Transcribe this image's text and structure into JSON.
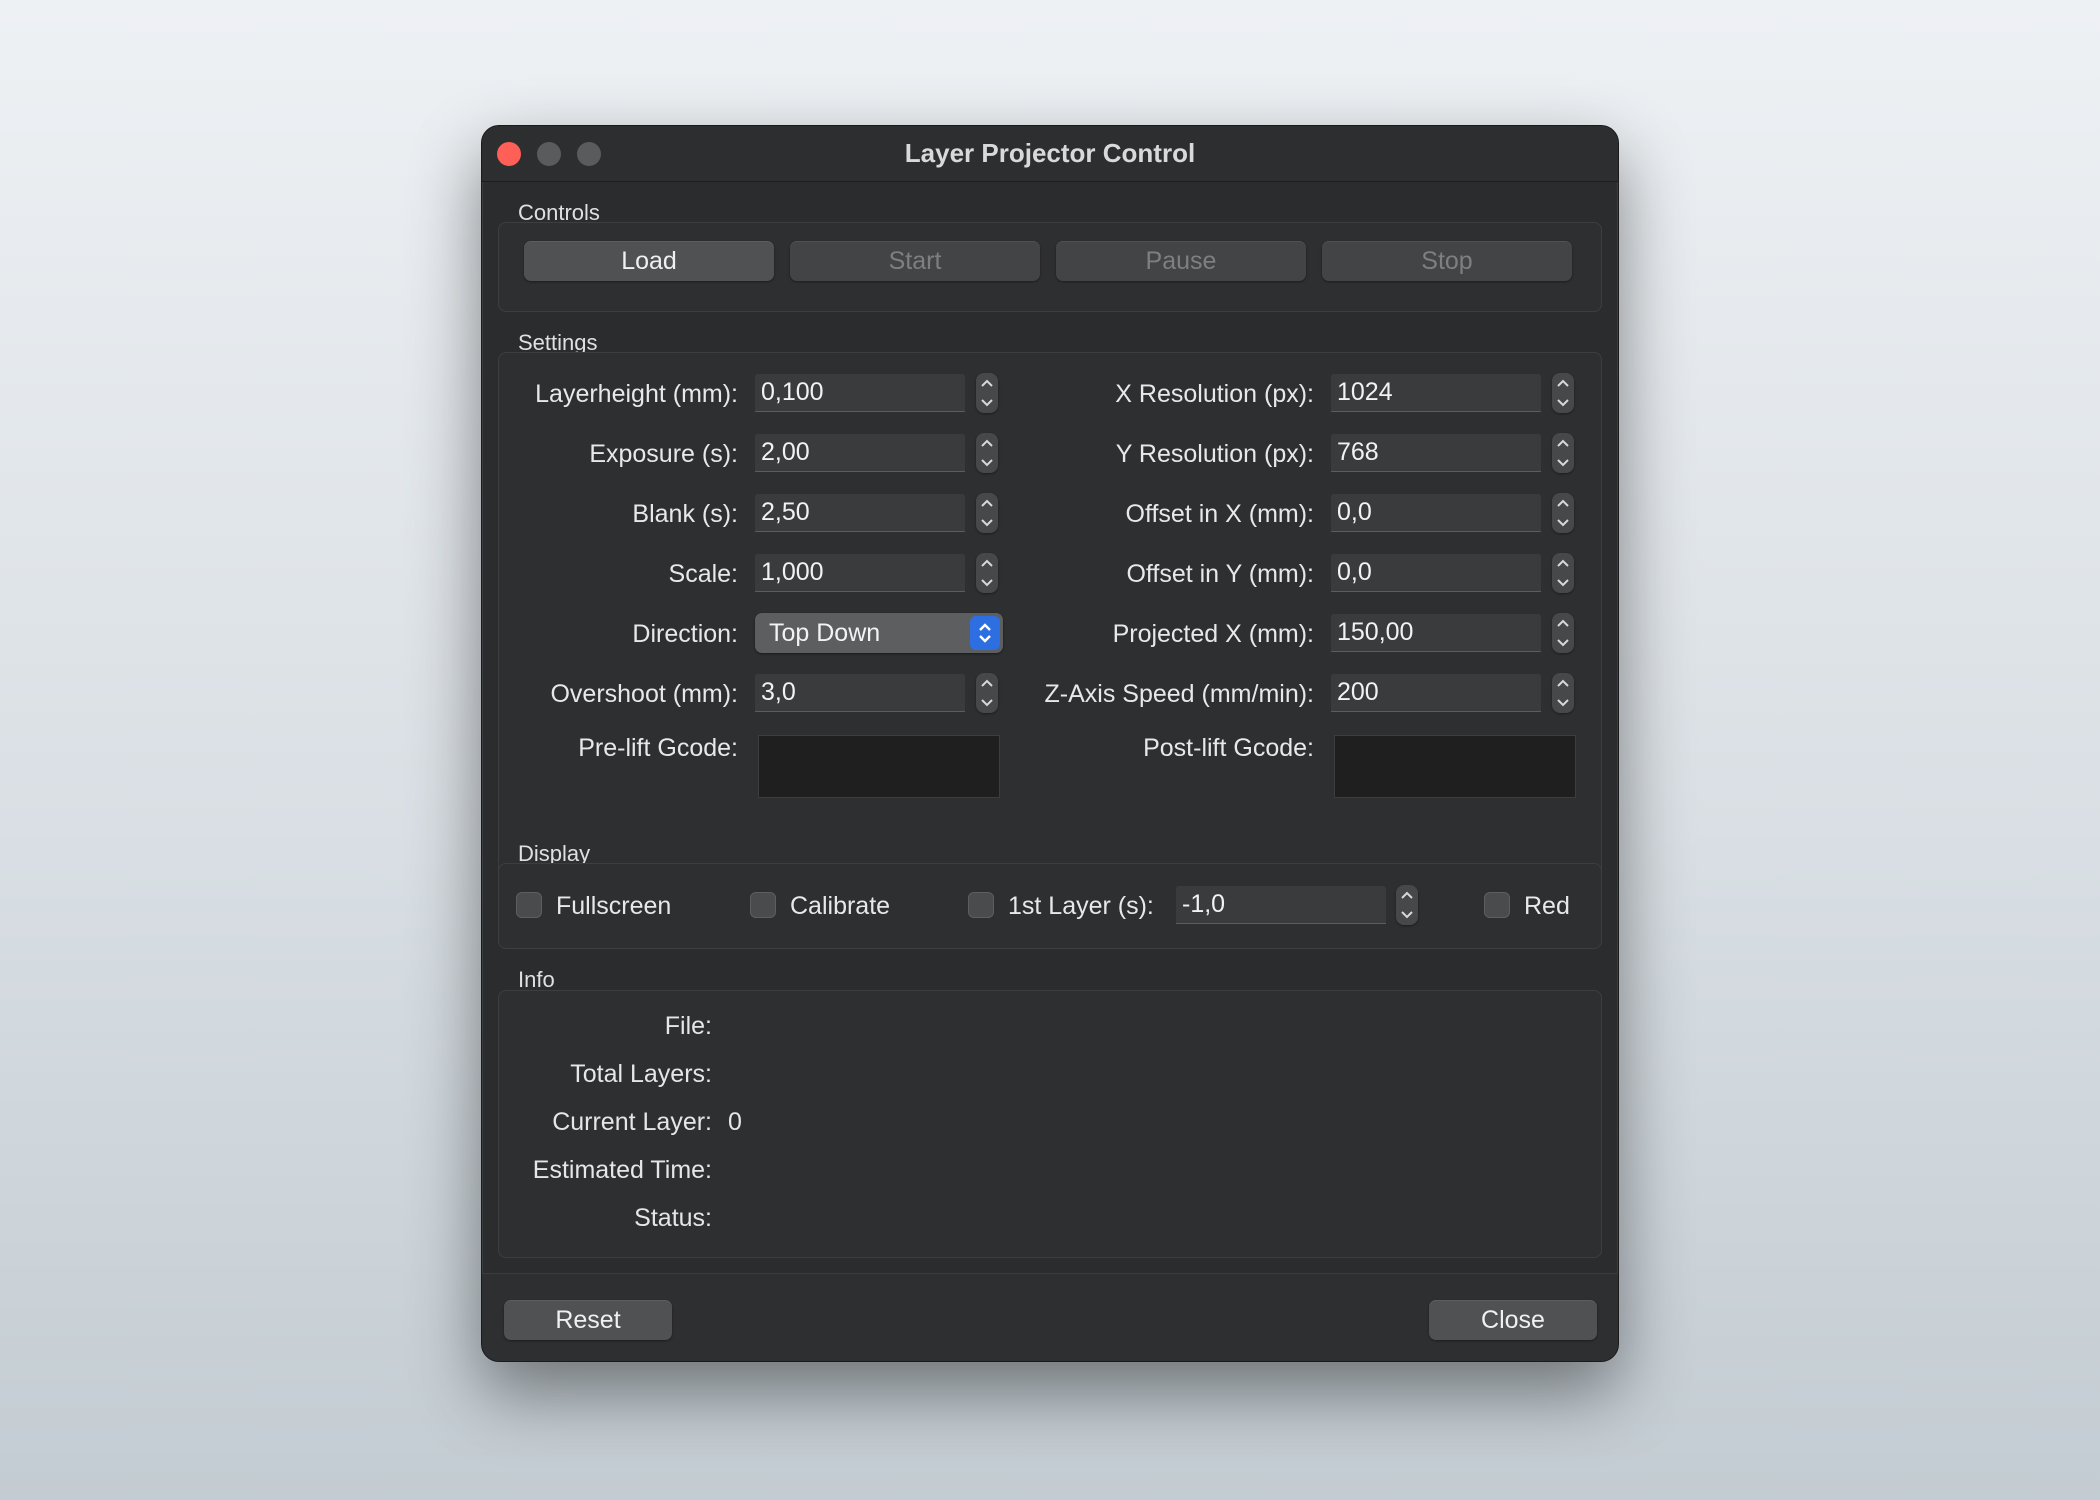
{
  "window": {
    "title": "Layer Projector Control"
  },
  "controls": {
    "section_label": "Controls",
    "load": "Load",
    "start": "Start",
    "pause": "Pause",
    "stop": "Stop"
  },
  "settings": {
    "section_label": "Settings",
    "layerheight_label": "Layerheight (mm):",
    "layerheight_value": "0,100",
    "exposure_label": "Exposure (s):",
    "exposure_value": "2,00",
    "blank_label": "Blank (s):",
    "blank_value": "2,50",
    "scale_label": "Scale:",
    "scale_value": "1,000",
    "direction_label": "Direction:",
    "direction_value": "Top Down",
    "overshoot_label": "Overshoot (mm):",
    "overshoot_value": "3,0",
    "prelift_label": "Pre-lift Gcode:",
    "xres_label": "X Resolution (px):",
    "xres_value": "1024",
    "yres_label": "Y Resolution (px):",
    "yres_value": "768",
    "offx_label": "Offset in X (mm):",
    "offx_value": "0,0",
    "offy_label": "Offset in Y (mm):",
    "offy_value": "0,0",
    "projx_label": "Projected X (mm):",
    "projx_value": "150,00",
    "zspeed_label": "Z-Axis Speed (mm/min):",
    "zspeed_value": "200",
    "postlift_label": "Post-lift Gcode:"
  },
  "display": {
    "section_label": "Display",
    "fullscreen": "Fullscreen",
    "calibrate": "Calibrate",
    "first_layer_label": "1st Layer (s):",
    "first_layer_value": "-1,0",
    "red": "Red"
  },
  "info": {
    "section_label": "Info",
    "file_label": "File:",
    "total_layers_label": "Total Layers:",
    "current_layer_label": "Current Layer:",
    "current_layer_value": "0",
    "estimated_time_label": "Estimated Time:",
    "status_label": "Status:"
  },
  "footer": {
    "reset": "Reset",
    "close": "Close"
  },
  "colors": {
    "close_dot": "#fe5f57",
    "select_accent": "#2d6fe0",
    "window_bg": "#2b2c2e"
  }
}
